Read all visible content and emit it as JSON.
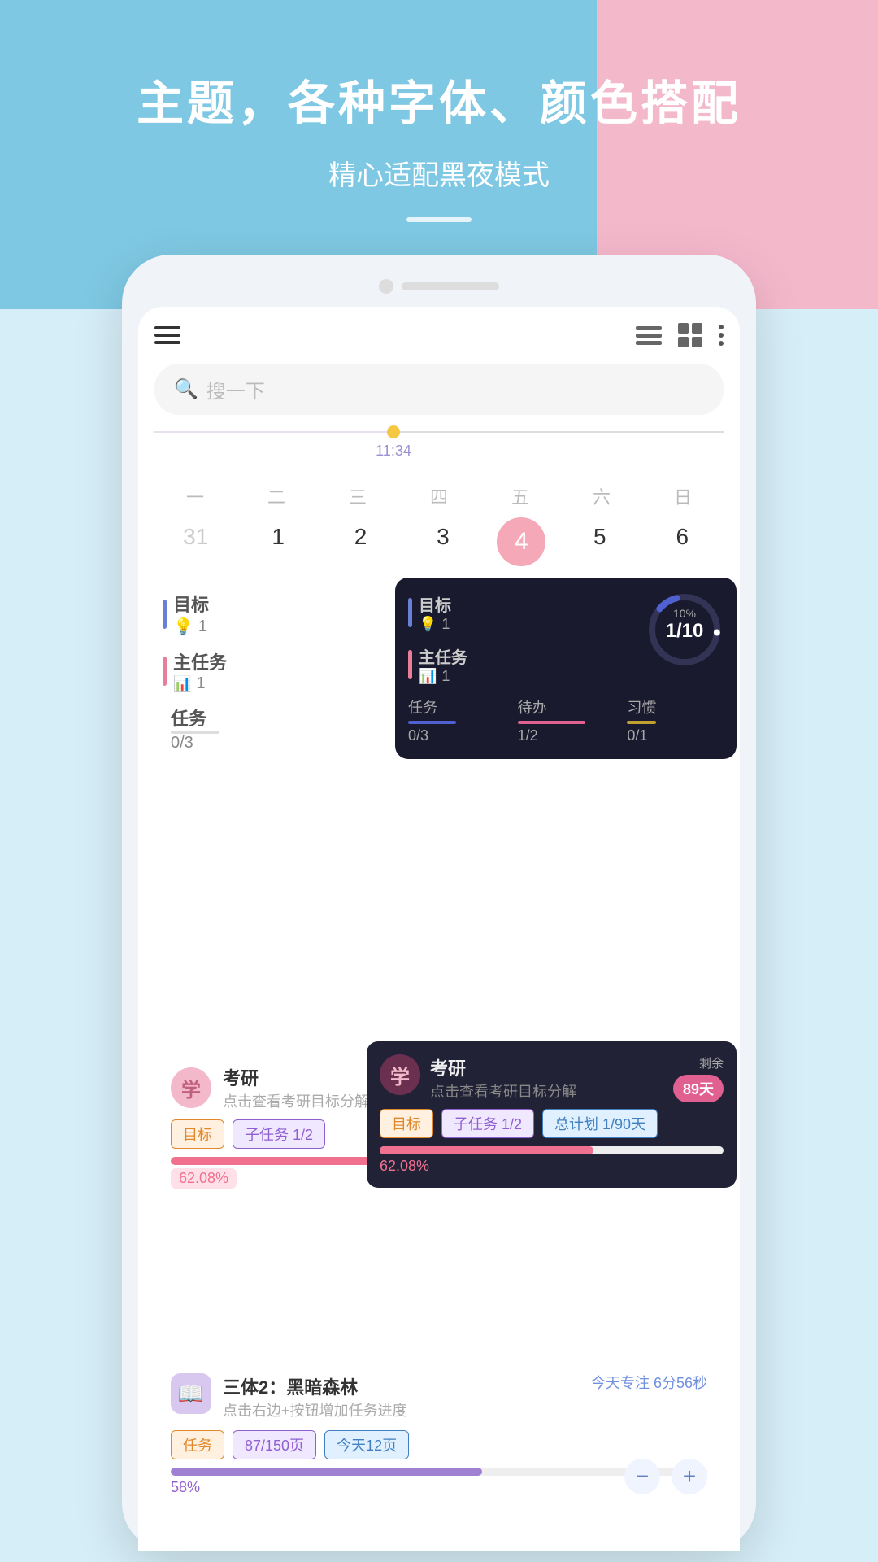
{
  "hero": {
    "title": "主题，各种字体、颜色搭配",
    "subtitle": "精心适配黑夜模式",
    "divider": true
  },
  "app": {
    "search_placeholder": "搜一下",
    "timeline_time": "11:34",
    "week_days": [
      "一",
      "二",
      "三",
      "四",
      "五",
      "六",
      "日"
    ],
    "week_dates": [
      "31",
      "1",
      "2",
      "3",
      "4",
      "5",
      "6"
    ],
    "today_index": 4,
    "stats_light": {
      "goal_label": "目标",
      "goal_count": "1",
      "main_task_label": "主任务",
      "main_task_count": "1",
      "task_label": "任务",
      "task_count": "0/3"
    },
    "stats_dark": {
      "goal_label": "目标",
      "goal_count": "1",
      "main_task_label": "主任务",
      "main_task_count": "1",
      "progress_pct": "10%",
      "progress_val": "1/10",
      "task_label": "任务",
      "task_val": "0/3",
      "todo_label": "待办",
      "todo_val": "1/2",
      "habit_label": "习惯",
      "habit_val": "0/1"
    },
    "study_card": {
      "avatar_text": "学",
      "title": "考研",
      "desc": "点击查看考研目标分解",
      "remaining_label": "剩余",
      "remaining_days": "89天",
      "tag1": "目标",
      "tag2": "子任务 1/2",
      "tag3": "总计划 1/90天",
      "progress_pct": "62.08%",
      "progress_pct_short": "62.08%"
    },
    "book_card": {
      "title": "三体2：黑暗森林",
      "desc": "点击右边+按钮增加任务进度",
      "focus_label": "今天专注 6分56秒",
      "tag1": "任务",
      "tag2": "87/150页",
      "tag3": "今天12页",
      "progress_pct": "58%"
    }
  },
  "colors": {
    "blue_bg": "#7ec8e3",
    "pink_bg": "#f4b8cb",
    "light_blue_bg": "#d6eef8",
    "accent_pink": "#f4a8b8",
    "accent_purple": "#9b8fd4",
    "dark_bg": "#1a1a2e",
    "progress_blue": "#5060d0",
    "progress_pink": "#e06090"
  }
}
